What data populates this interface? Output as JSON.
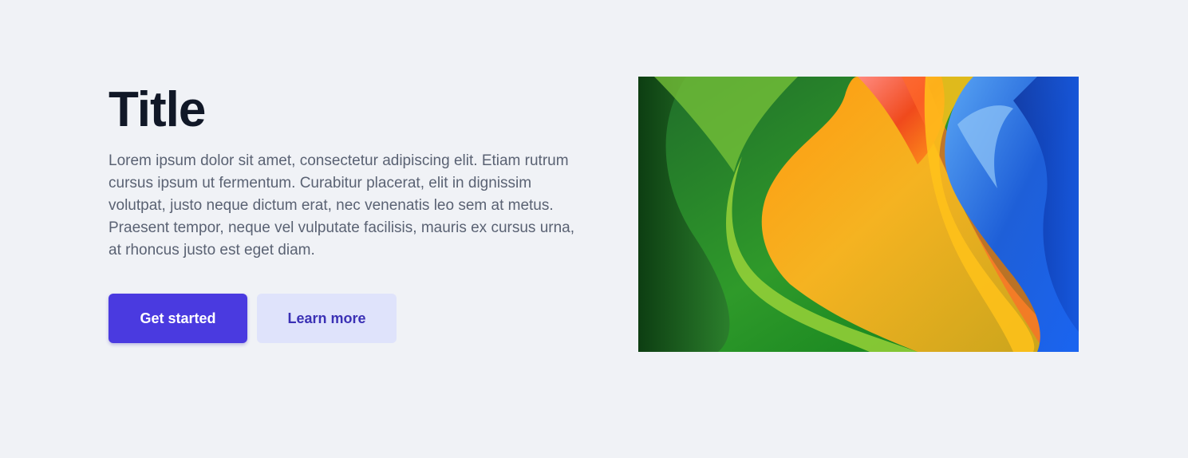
{
  "hero": {
    "title": "Title",
    "description": "Lorem ipsum dolor sit amet, consectetur adipiscing elit. Etiam rutrum cursus ipsum ut fermentum. Curabitur placerat, elit in dignissim volutpat, justo neque dictum erat, nec venenatis leo sem at metus. Praesent tempor, neque vel vulputate facilisis, mauris ex cursus urna, at rhoncus justo est eget diam.",
    "primary_button": "Get started",
    "secondary_button": "Learn more"
  },
  "colors": {
    "background": "#f0f2f6",
    "title": "#111827",
    "body_text": "#5a6273",
    "primary_button": "#4a3ae0",
    "secondary_button_bg": "#dfe3fb",
    "secondary_button_text": "#3b31b5"
  }
}
